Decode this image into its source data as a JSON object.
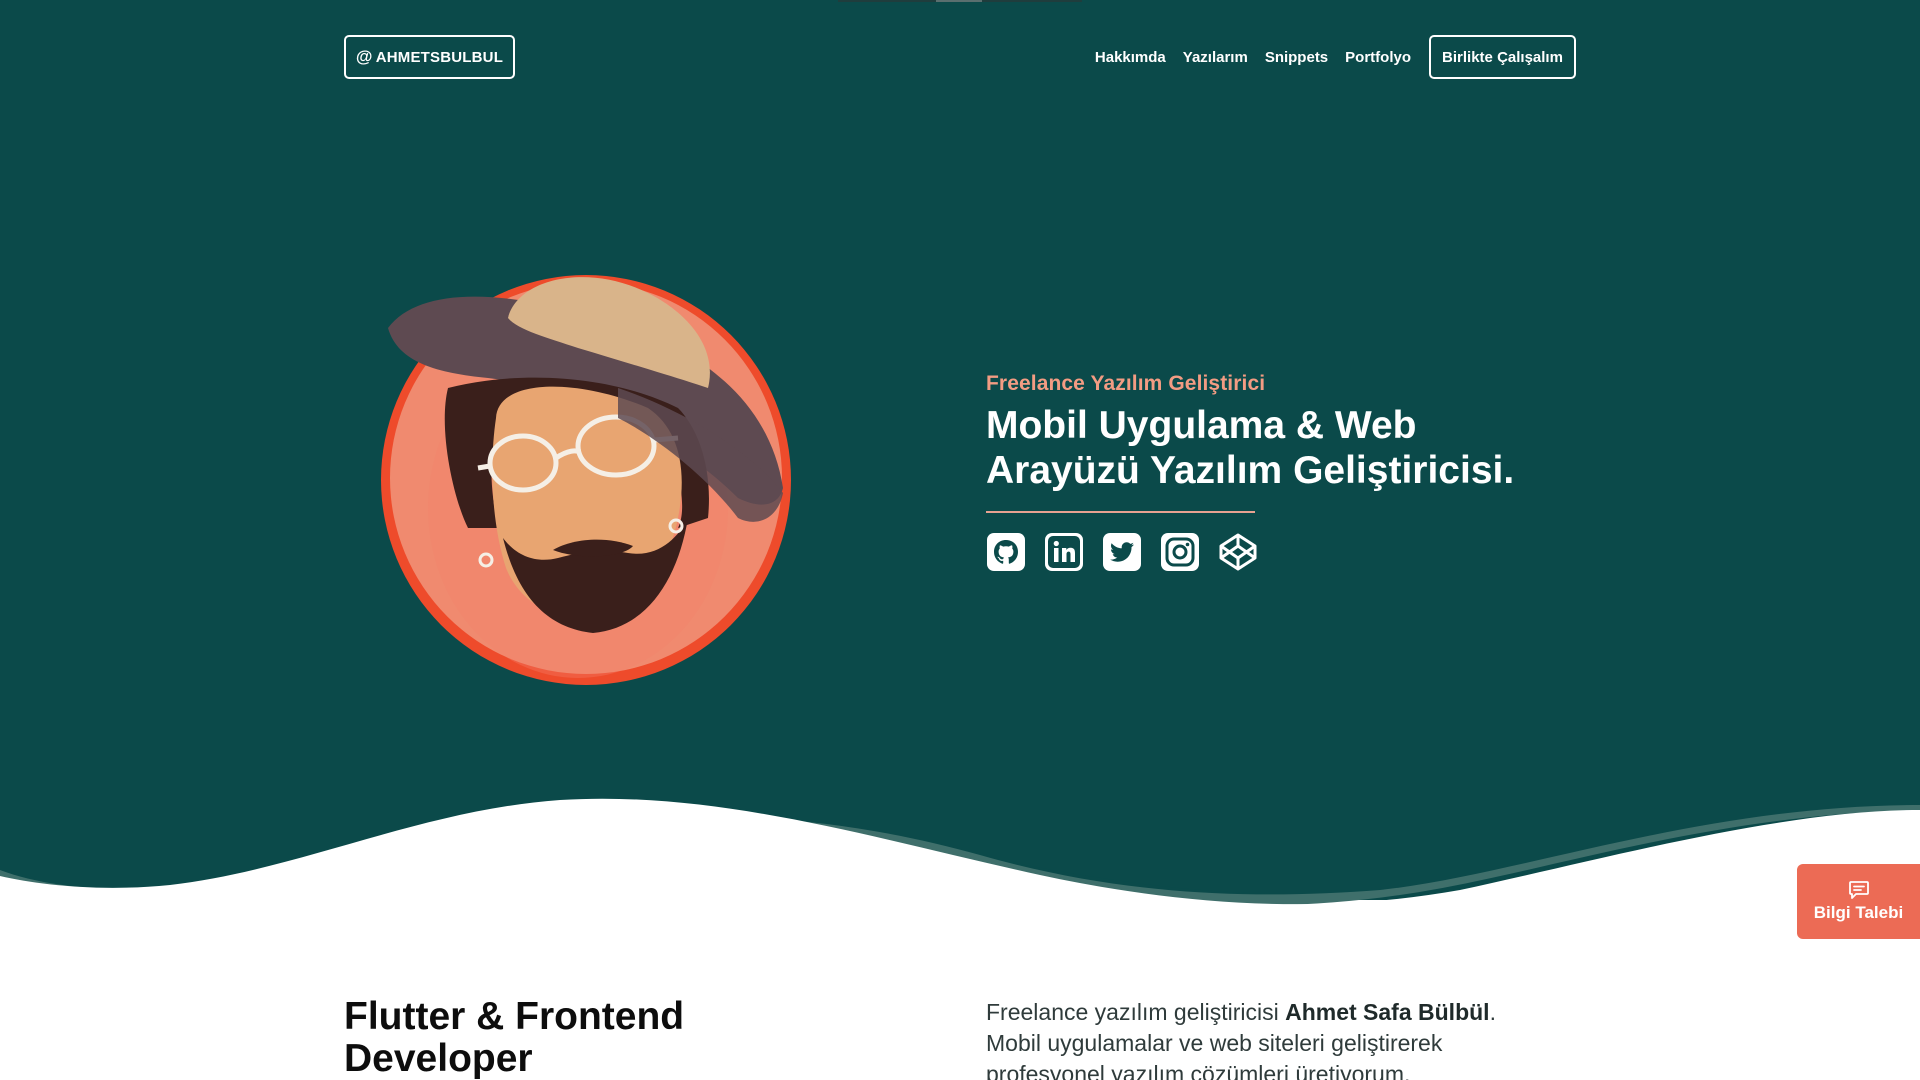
{
  "header": {
    "logo_at": "@",
    "logo_text": "AHMETSBULBUL",
    "nav": [
      "Hakkımda",
      "Yazılarım",
      "Snippets",
      "Portfolyo"
    ],
    "cta": "Birlikte Çalışalım"
  },
  "hero": {
    "eyebrow": "Freelance Yazılım Geliştirici",
    "headline_line1": "Mobil Uygulama & Web",
    "headline_line2": "Arayüzü Yazılım Geliştiricisi.",
    "socials": [
      "github-icon",
      "linkedin-icon",
      "twitter-icon",
      "instagram-icon",
      "codepen-icon"
    ]
  },
  "intro": {
    "title_line1": "Flutter & Frontend",
    "title_line2": "Developer",
    "text_prefix": "Freelance yazılım geliştiricisi ",
    "text_name": "Ahmet Safa Bülbül",
    "text_suffix_1": ".",
    "text_line2": "Mobil uygulamalar ve web siteleri geliştirerek",
    "text_line3": "profesyonel yazılım çözümleri üretiyorum."
  },
  "float_button": {
    "label": "Bilgi Talebi",
    "icon": "message-icon"
  },
  "colors": {
    "hero_bg": "#0b4a4a",
    "accent": "#ec6b55",
    "eyebrow": "#f39c83"
  }
}
